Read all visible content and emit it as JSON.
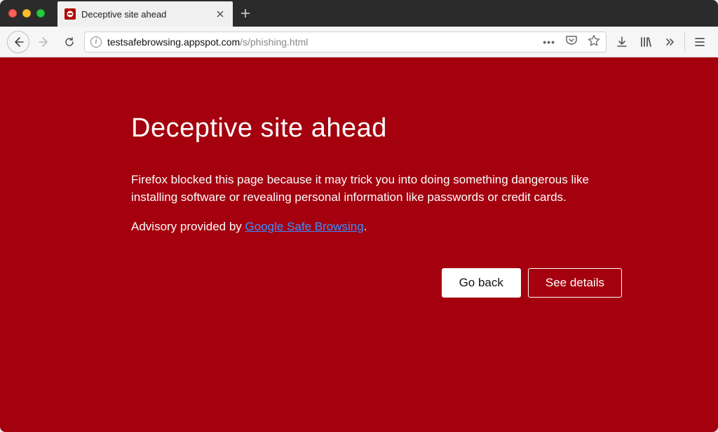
{
  "tab": {
    "title": "Deceptive site ahead"
  },
  "addressbar": {
    "domain": "testsafebrowsing.appspot.com",
    "path": "/s/phishing.html"
  },
  "warning": {
    "title": "Deceptive site ahead",
    "body": "Firefox blocked this page because it may trick you into doing something dangerous like installing software or revealing personal information like passwords or credit cards.",
    "advisory_prefix": "Advisory provided by ",
    "advisory_link_text": "Google Safe Browsing",
    "advisory_suffix": ".",
    "go_back_label": "Go back",
    "see_details_label": "See details"
  },
  "colors": {
    "danger_bg": "#a4000e",
    "link": "#3e8cff"
  }
}
